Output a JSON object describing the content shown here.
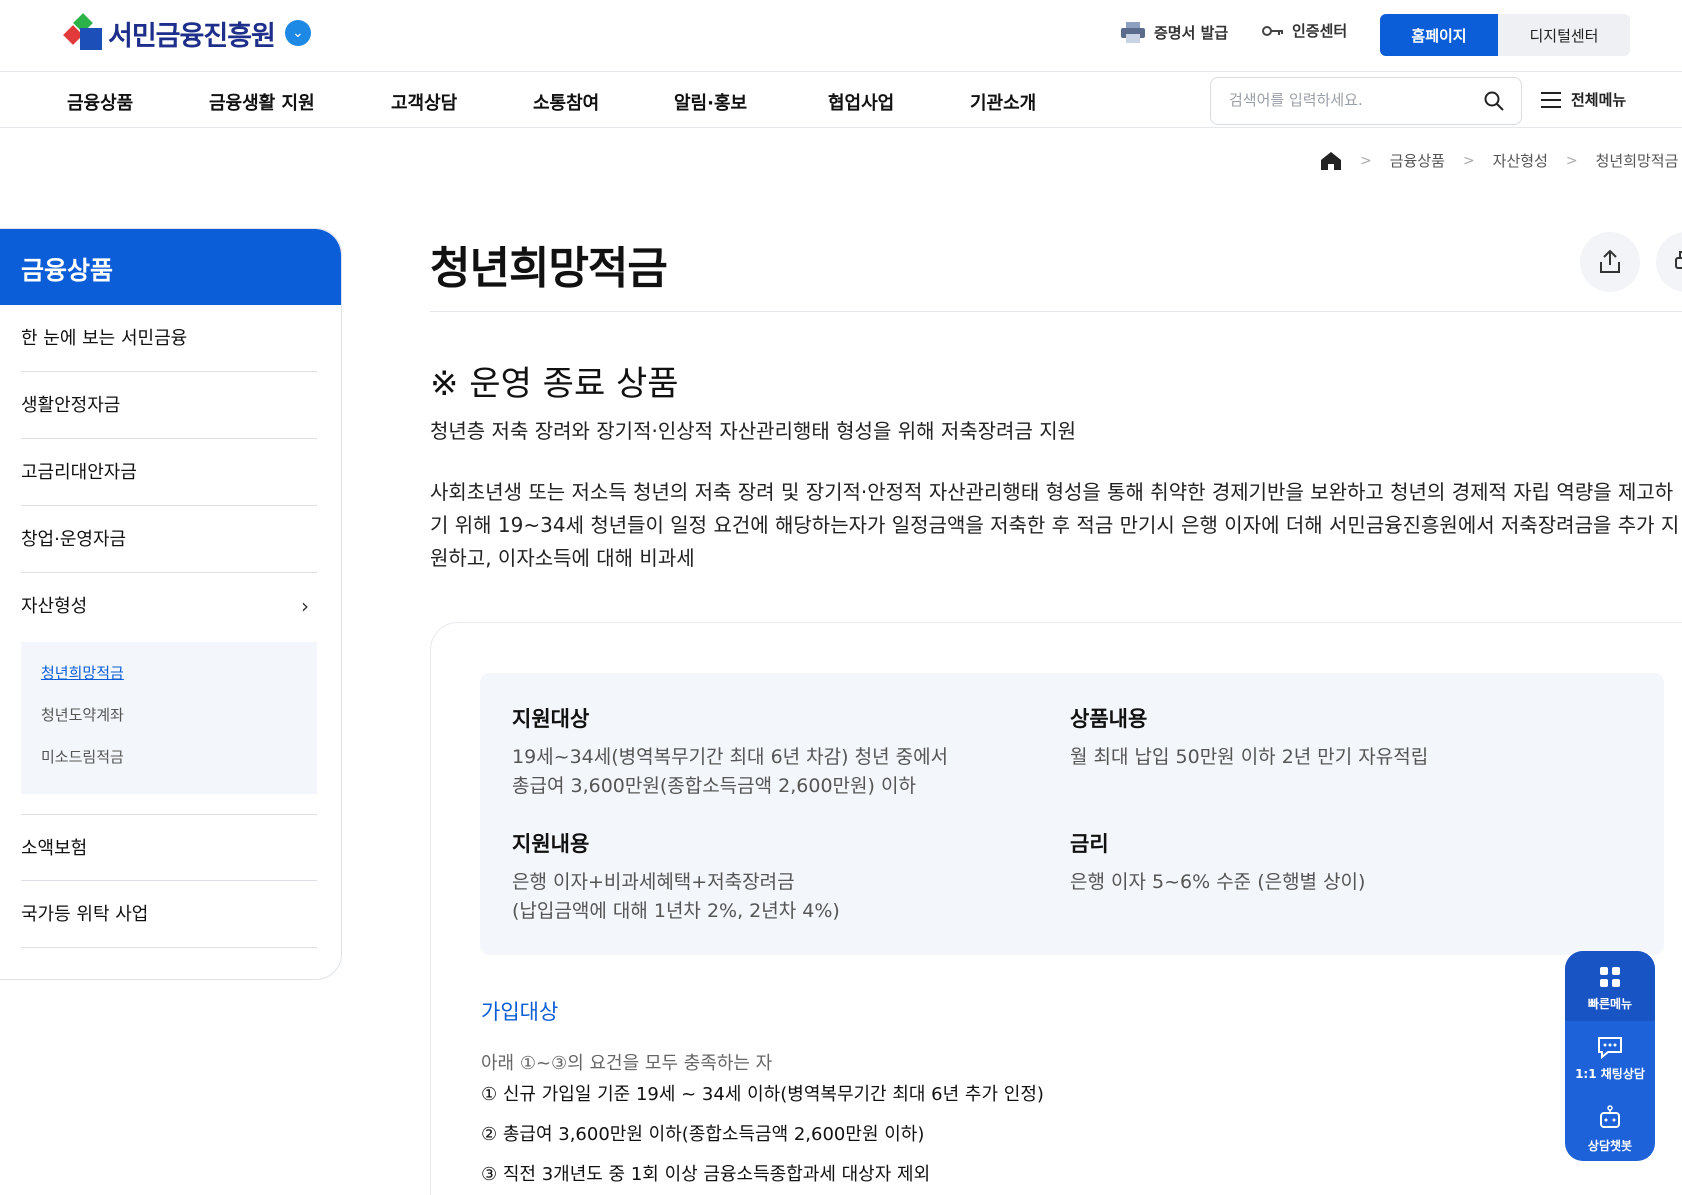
{
  "header": {
    "logo_text": "서민금융진흥원",
    "util_links": [
      {
        "label": "증명서 발급",
        "icon": "printer-icon"
      },
      {
        "label": "인증센터",
        "icon": "key-icon"
      }
    ],
    "btn_home": "홈페이지",
    "btn_digital": "디지털센터"
  },
  "gnb": {
    "items": [
      "금융상품",
      "금융생활 지원",
      "고객상담",
      "소통참여",
      "알림·홍보",
      "협업사업",
      "기관소개"
    ],
    "search_placeholder": "검색어를 입력하세요.",
    "allmenu_label": "전체메뉴"
  },
  "breadcrumb": [
    "금융상품",
    "자산형성",
    "청년희망적금"
  ],
  "sidebar": {
    "title": "금융상품",
    "items": [
      "한 눈에 보는 서민금융",
      "생활안정자금",
      "고금리대안자금",
      "창업·운영자금",
      "자산형성",
      "소액보험",
      "국가등 위탁 사업"
    ],
    "sub_items": [
      "청년희망적금",
      "청년도약계좌",
      "미소드림적금"
    ]
  },
  "main": {
    "title": "청년희망적금",
    "notice": "※ 운영 종료 상품",
    "desc1": "청년층 저축 장려와 장기적·인상적 자산관리행태 형성을 위해 저축장려금 지원",
    "desc2": "사회초년생 또는 저소득 청년의 저축 장려 및 장기적·안정적 자산관리행태 형성을 통해 취약한 경제기반을 보완하고 청년의 경제적 자립 역량을 제고하기 위해 19~34세 청년들이 일정 요건에 해당하는자가 일정금액을 저축한 후 적금 만기시 은행 이자에 더해 서민금융진흥원에서 저축장려금을 추가 지원하고, 이자소득에 대해 비과세",
    "info": {
      "target_h": "지원대상",
      "target_t1": "19세~34세(병역복무기간 최대 6년 차감) 청년 중에서",
      "target_t2": "총급여 3,600만원(종합소득금액 2,600만원) 이하",
      "product_h": "상품내용",
      "product_t": "월 최대 납입 50만원 이하 2년 만기 자유적립",
      "support_h": "지원내용",
      "support_t1": "은행 이자+비과세혜택+저축장려금",
      "support_t2": "(납입금액에 대해 1년차 2%, 2년차 4%)",
      "rate_h": "금리",
      "rate_t": "은행 이자 5~6% 수준 (은행별 상이)"
    },
    "join": {
      "heading": "가입대상",
      "lead": "아래 ①~③의 요건을 모두 충족하는 자",
      "items": [
        "① 신규 가입일 기준 19세 ~ 34세 이하(병역복무기간 최대 6년 추가 인정)",
        "② 총급여 3,600만원 이하(종합소득금액 2,600만원 이하)",
        "③ 직전 3개년도 중 1회 이상 금융소득종합과세 대상자 제외"
      ]
    }
  },
  "quick_menu": [
    "빠른메뉴",
    "1:1 채팅상담",
    "상담챗봇"
  ],
  "colors": {
    "brand": "#0b5ed7",
    "quick": "#1d62d8"
  }
}
